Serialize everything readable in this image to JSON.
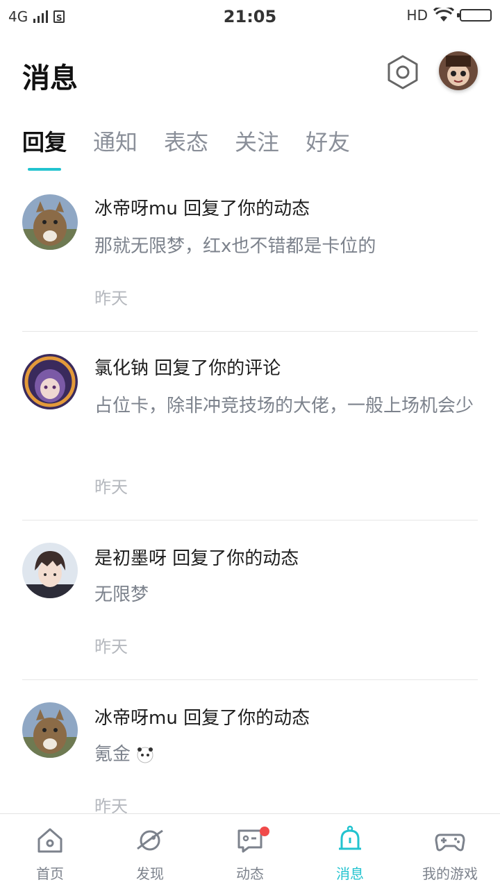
{
  "status_bar": {
    "network": "4G",
    "sim": "S",
    "time": "21:05",
    "hd": "HD"
  },
  "header": {
    "title": "消息",
    "settings_icon": "gear-hexagon-icon"
  },
  "tabs": [
    {
      "label": "回复",
      "active": true
    },
    {
      "label": "通知",
      "active": false
    },
    {
      "label": "表态",
      "active": false
    },
    {
      "label": "关注",
      "active": false
    },
    {
      "label": "好友",
      "active": false
    }
  ],
  "messages": [
    {
      "title": "冰帝呀mu 回复了你的动态",
      "body": "那就无限梦，红x也不错都是卡位的",
      "time": "昨天",
      "avatar": "cat-avatar"
    },
    {
      "title": "氯化钠 回复了你的评论",
      "body": "占位卡，除非冲竞技场的大佬，一般上场机会少",
      "time": "昨天",
      "avatar": "anime-purple-avatar"
    },
    {
      "title": "是初墨呀 回复了你的动态",
      "body": "无限梦",
      "time": "昨天",
      "avatar": "anime-boy-avatar"
    },
    {
      "title": "冰帝呀mu 回复了你的动态",
      "body": "氪金",
      "time": "昨天",
      "avatar": "cat-avatar"
    }
  ],
  "bottom_nav": [
    {
      "label": "首页",
      "icon": "home-icon"
    },
    {
      "label": "发现",
      "icon": "planet-icon"
    },
    {
      "label": "动态",
      "icon": "chat-icon",
      "badge": true
    },
    {
      "label": "消息",
      "icon": "bell-icon",
      "active": true
    },
    {
      "label": "我的游戏",
      "icon": "gamepad-icon"
    }
  ],
  "colors": {
    "accent": "#22c3cf",
    "badge": "#f04a4a",
    "muted": "#7c828c"
  }
}
